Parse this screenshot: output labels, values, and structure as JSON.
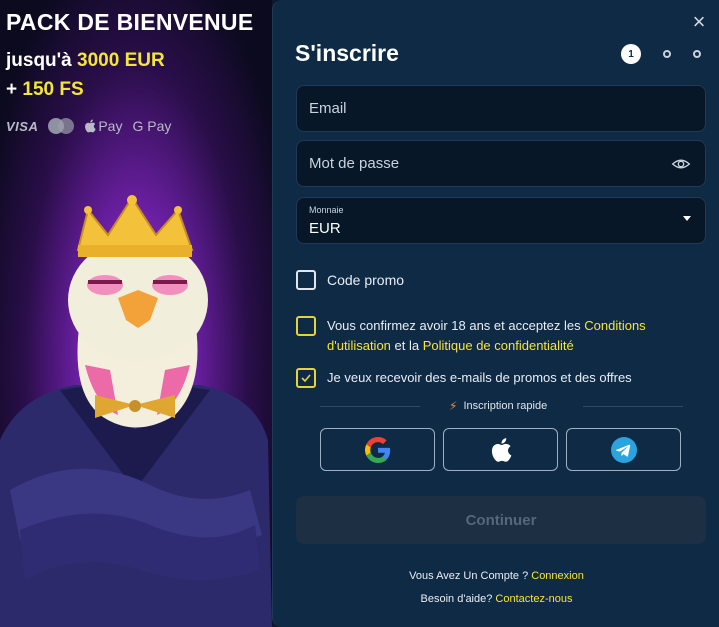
{
  "promo": {
    "title": "PACK DE BIENVENUE",
    "line1_prefix": "jusqu'à ",
    "line1_amount": "3000 EUR",
    "line2_prefix": "+ ",
    "line2_amount": "150 FS",
    "payments": {
      "visa": "VISA",
      "applepay": "Pay",
      "googlepay": "G Pay"
    }
  },
  "form": {
    "title": "S'inscrire",
    "step_current": "1",
    "email_placeholder": "Email",
    "password_placeholder": "Mot de passe",
    "currency_label": "Monnaie",
    "currency_value": "EUR",
    "promo_label": "Code promo",
    "terms_prefix": "Vous confirmez avoir 18 ans et acceptez les ",
    "terms_link": "Conditions d'utilisation",
    "terms_middle": " et la ",
    "privacy_link": "Politique de confidentialité",
    "mails_label": "Je veux recevoir des e-mails de promos et des offres",
    "mails_checked": true,
    "quick_label": "Inscription rapide",
    "continue_label": "Continuer"
  },
  "footer": {
    "account_prefix": "Vous Avez Un Compte ? ",
    "account_link": "Connexion",
    "help_prefix": "Besoin d'aide? ",
    "help_link": "Contactez-nous"
  },
  "colors": {
    "accent_yellow": "#f4e53a",
    "panel_bg": "#0f2a44",
    "field_bg": "#071727",
    "button_disabled_bg": "#1c2f43"
  },
  "icons": [
    "close-icon",
    "eye-icon",
    "dropdown-caret-icon",
    "check-icon",
    "bolt-icon",
    "google-icon",
    "apple-icon",
    "telegram-icon"
  ]
}
